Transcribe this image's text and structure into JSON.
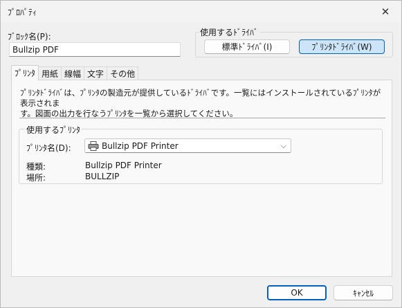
{
  "window": {
    "title": "ﾌﾟﾛﾊﾟﾃｨ"
  },
  "block_name": {
    "label": "ﾌﾞﾛｯｸ名(P):",
    "value": "Bullzip PDF"
  },
  "driver_group": {
    "caption": "使用するﾄﾞﾗｲﾊﾞ",
    "standard_label": "標準ﾄﾞﾗｲﾊﾞ(I)",
    "printer_label": "ﾌﾟﾘﾝﾀﾄﾞﾗｲﾊﾞ(W)"
  },
  "tabs": [
    {
      "label": "ﾌﾟﾘﾝﾀ"
    },
    {
      "label": "用紙"
    },
    {
      "label": "線幅"
    },
    {
      "label": "文字"
    },
    {
      "label": "その他"
    }
  ],
  "printer_tab": {
    "description_line1": "ﾌﾟﾘﾝﾀﾄﾞﾗｲﾊﾞは、ﾌﾟﾘﾝﾀの製造元が提供しているﾄﾞﾗｲﾊﾞです。一覧にはインストールされているﾌﾟﾘﾝﾀが表示されま",
    "description_line2": "す。図面の出力を行なうﾌﾟﾘﾝﾀを一覧から選択してください。",
    "group_caption": "使用するﾌﾟﾘﾝﾀ",
    "printer_name_label": "ﾌﾟﾘﾝﾀ名(D):",
    "printer_name_value": "Bullzip PDF Printer",
    "type_label": "種類:",
    "type_value": "Bullzip PDF Printer",
    "location_label": "場所:",
    "location_value": "BULLZIP"
  },
  "footer": {
    "ok_label": "OK",
    "cancel_label": "ｷｬﾝｾﾙ"
  },
  "icons": {
    "close": "close-icon",
    "printer": "printer-icon",
    "dropdown": "chevron-down-icon"
  },
  "colors": {
    "accent": "#005fb8",
    "selected_fill": "#cce4f7"
  }
}
